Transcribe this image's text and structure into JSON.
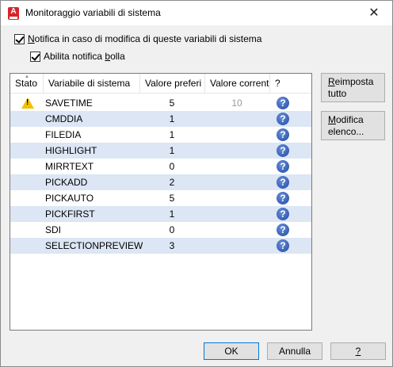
{
  "window": {
    "title": "Monitoraggio variabili di sistema",
    "app_icon_letter": "A",
    "close_symbol": "✕"
  },
  "options": {
    "notify_prefix": "",
    "notify_hotkey": "N",
    "notify_rest": "otifica in caso di modifica di queste variabili di sistema",
    "bubble_prefix": "Abilita notifica ",
    "bubble_hotkey": "b",
    "bubble_rest": "olla"
  },
  "table": {
    "headers": {
      "status": "Stato",
      "variable": "Variabile di sistema",
      "preferred": "Valore preferi",
      "current": "Valore corrent",
      "help": "?"
    },
    "rows": [
      {
        "status": "warning-icon",
        "name": "SAVETIME",
        "preferred": "5",
        "current": "10"
      },
      {
        "status": "",
        "name": "CMDDIA",
        "preferred": "1",
        "current": ""
      },
      {
        "status": "",
        "name": "FILEDIA",
        "preferred": "1",
        "current": ""
      },
      {
        "status": "",
        "name": "HIGHLIGHT",
        "preferred": "1",
        "current": ""
      },
      {
        "status": "",
        "name": "MIRRTEXT",
        "preferred": "0",
        "current": ""
      },
      {
        "status": "",
        "name": "PICKADD",
        "preferred": "2",
        "current": ""
      },
      {
        "status": "",
        "name": "PICKAUTO",
        "preferred": "5",
        "current": ""
      },
      {
        "status": "",
        "name": "PICKFIRST",
        "preferred": "1",
        "current": ""
      },
      {
        "status": "",
        "name": "SDI",
        "preferred": "0",
        "current": ""
      },
      {
        "status": "",
        "name": "SELECTIONPREVIEW",
        "preferred": "3",
        "current": ""
      }
    ]
  },
  "buttons": {
    "reset_hotkey": "R",
    "reset_line1_rest": "eimposta",
    "reset_line2": "tutto",
    "modify_hotkey": "M",
    "modify_line1_rest": "odifica",
    "modify_line2": "elenco...",
    "ok": "OK",
    "cancel": "Annulla",
    "help": "?"
  },
  "colors": {
    "alt_row": "#dce6f4",
    "help_icon": "#1f4aa8",
    "warning": "#f2c200",
    "app_icon": "#d6252b"
  }
}
